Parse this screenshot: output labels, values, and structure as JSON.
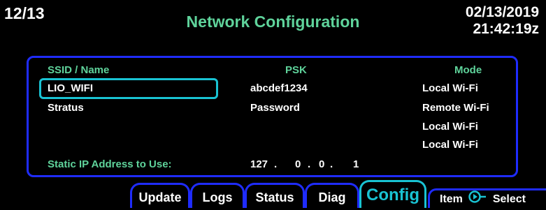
{
  "header": {
    "page": "12/13",
    "title": "Network Configuration",
    "date": "02/13/2019",
    "time": "21:42:19z"
  },
  "table": {
    "columns": {
      "ssid": "SSID / Name",
      "psk": "PSK",
      "mode": "Mode"
    },
    "rows": [
      {
        "ssid": "LIO_WIFI",
        "psk": "abcdef1234",
        "mode": "Local Wi-Fi"
      },
      {
        "ssid": "Stratus",
        "psk": "Password",
        "mode": "Remote Wi-Fi"
      },
      {
        "ssid": "",
        "psk": "",
        "mode": "Local Wi-Fi"
      },
      {
        "ssid": "",
        "psk": "",
        "mode": "Local Wi-Fi"
      }
    ]
  },
  "static_ip": {
    "label": "Static IP Address to Use:",
    "octets": [
      "127",
      ".",
      "0",
      ".",
      "0",
      ".",
      "1"
    ]
  },
  "tabs": [
    {
      "label": "Update"
    },
    {
      "label": "Logs"
    },
    {
      "label": "Status"
    },
    {
      "label": "Diag"
    },
    {
      "label": "Config"
    }
  ],
  "softkey": {
    "prefix": "Item",
    "icon": "knob-icon",
    "suffix": "Select"
  },
  "colors": {
    "accent_green": "#5fd39b",
    "border_blue": "#1f2cff",
    "selected_cyan": "#19c3d3"
  }
}
